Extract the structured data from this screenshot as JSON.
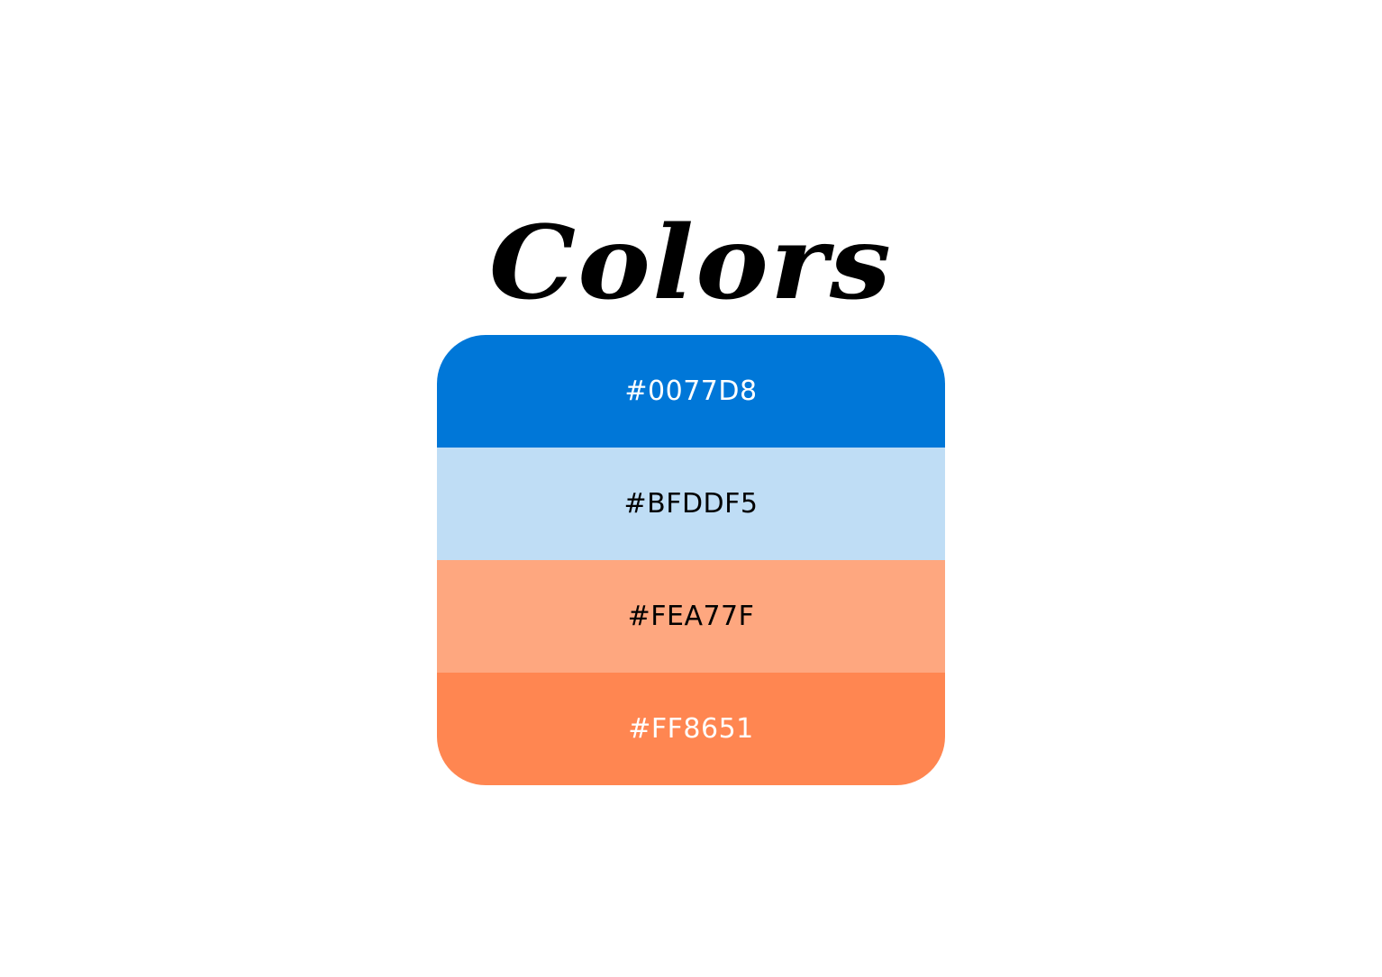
{
  "title": "Colors",
  "swatches": [
    {
      "label": "#0077D8",
      "color": "#0077D8",
      "text_color": "#FFFFFF"
    },
    {
      "label": "#BFDDF5",
      "color": "#BFDDF5",
      "text_color": "#000000"
    },
    {
      "label": "#FEA77F",
      "color": "#FEA77F",
      "text_color": "#000000"
    },
    {
      "label": "#FF8651",
      "color": "#FF8651",
      "text_color": "#FFFFFF"
    }
  ]
}
